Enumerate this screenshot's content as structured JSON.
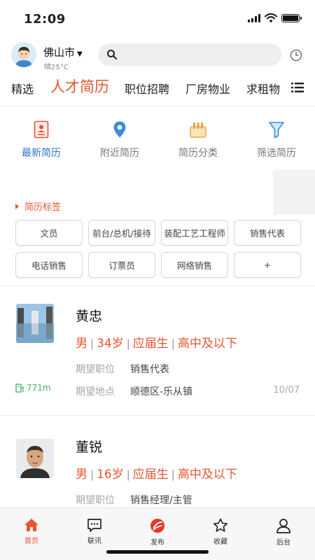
{
  "status_bar": {
    "time": "12:09"
  },
  "header": {
    "city": "佛山市",
    "weather": "晴25°C",
    "search_placeholder": ""
  },
  "tabs": [
    {
      "label": "精选",
      "active": false
    },
    {
      "label": "人才简历",
      "active": true
    },
    {
      "label": "职位招聘",
      "active": false
    },
    {
      "label": "厂房物业",
      "active": false
    },
    {
      "label": "求租物",
      "active": false
    }
  ],
  "features": [
    {
      "label": "最新简历",
      "icon": "resume-icon",
      "active": true
    },
    {
      "label": "附近简历",
      "icon": "location-pin-icon",
      "active": false
    },
    {
      "label": "简历分类",
      "icon": "category-icon",
      "active": false
    },
    {
      "label": "筛选简历",
      "icon": "filter-icon",
      "active": false
    }
  ],
  "tags_section": {
    "title": "简历标签",
    "tags": [
      "文员",
      "前台/总机/接待",
      "装配工艺工程师",
      "销售代表",
      "电话销售",
      "订票员",
      "网络销售",
      "+"
    ]
  },
  "resumes": [
    {
      "name": "黄忠",
      "gender": "男",
      "age": "34岁",
      "status": "应届生",
      "education": "高中及以下",
      "position_label": "期望职位",
      "position": "销售代表",
      "location_label": "期望地点",
      "location": "顺德区-乐从镇",
      "date": "10/07",
      "distance": "771m"
    },
    {
      "name": "董锐",
      "gender": "男",
      "age": "16岁",
      "status": "应届生",
      "education": "高中及以下",
      "position_label": "期望职位",
      "position": "销售经理/主管"
    }
  ],
  "bottom_nav": [
    {
      "label": "首页",
      "icon": "home-icon",
      "active": true
    },
    {
      "label": "联讯",
      "icon": "message-icon",
      "active": false
    },
    {
      "label": "发布",
      "icon": "publish-icon",
      "active": false
    },
    {
      "label": "收藏",
      "icon": "star-icon",
      "active": false
    },
    {
      "label": "后台",
      "icon": "user-icon",
      "active": false
    }
  ],
  "colors": {
    "accent": "#e8552f",
    "active_blue": "#2b74c7",
    "distance_green": "#3cb371"
  }
}
